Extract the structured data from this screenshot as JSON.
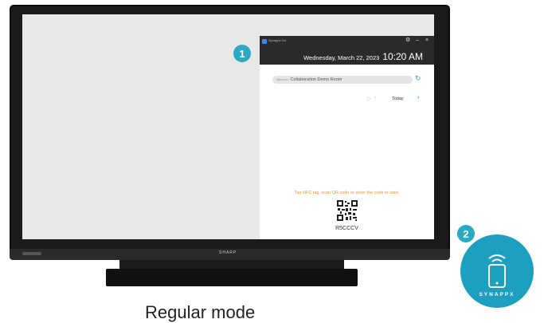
{
  "panel": {
    "app_name": "Synappx Go",
    "date": "Wednesday, March 22, 2023",
    "time": "10:20 AM",
    "room_prefix": "Welcome",
    "room_name": "Collaboration Demo Room",
    "today_label": "Today",
    "instruction": "Tap NFC tag, scan QR code or enter the code to start.",
    "code": "R5CCCV"
  },
  "tv": {
    "brand": "SHARP"
  },
  "callouts": {
    "one": "1",
    "two": "2"
  },
  "synappx": {
    "label": "SYNAPPX"
  },
  "caption": "Regular mode",
  "colors": {
    "accent": "#2aa8c4",
    "orange_text": "#e0963a",
    "header_bg": "#2b2b2b"
  },
  "icons": [
    "settings-gear-icon",
    "minimize-icon",
    "close-icon",
    "refresh-icon",
    "calendar-icon",
    "chevron-left-icon",
    "chevron-right-icon",
    "qr-code",
    "phone-nfc-icon"
  ]
}
